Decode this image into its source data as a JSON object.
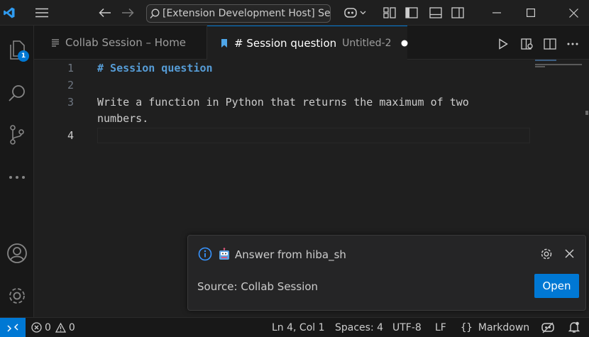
{
  "titlebar": {
    "search_text": "[Extension Development Host] Search"
  },
  "activity": {
    "explorer_badge": "1"
  },
  "tabs": [
    {
      "label": "Collab Session – Home",
      "description": ""
    },
    {
      "label": "# Session question",
      "description": "Untitled-2"
    }
  ],
  "editor": {
    "line_numbers": [
      "1",
      "2",
      "3",
      "4"
    ],
    "lines": [
      "# Session question",
      "",
      "Write a function in Python that returns the maximum of two",
      "numbers."
    ]
  },
  "notification": {
    "title": "Answer from hiba_sh",
    "source": "Source: Collab Session",
    "open_label": "Open"
  },
  "statusbar": {
    "errors": "0",
    "warnings": "0",
    "position": "Ln 4, Col 1",
    "spaces": "Spaces: 4",
    "encoding": "UTF-8",
    "eol": "LF",
    "language": "Markdown"
  },
  "colors": {
    "accent": "#0078d4",
    "heading": "#569cd6",
    "background": "#1f1f1f"
  },
  "icons": [
    "vscode-logo-icon",
    "menu-icon",
    "back-arrow-icon",
    "forward-arrow-icon",
    "search-icon",
    "copilot-icon",
    "chevron-down-icon",
    "customize-layout-icon",
    "toggle-sidebar-icon",
    "toggle-panel-icon",
    "toggle-secondary-sidebar-icon",
    "minimize-icon",
    "maximize-icon",
    "close-icon",
    "explorer-icon",
    "search-view-icon",
    "source-control-icon",
    "more-icon",
    "account-icon",
    "settings-gear-icon",
    "markdown-file-icon",
    "bookmark-file-icon",
    "dirty-dot-icon",
    "run-icon",
    "open-preview-icon",
    "editor-more-icon",
    "info-icon",
    "robot-icon",
    "notification-gear-icon",
    "notification-close-icon",
    "remote-icon",
    "error-icon",
    "warning-icon",
    "braces-icon",
    "copilot-status-icon",
    "bell-icon"
  ]
}
